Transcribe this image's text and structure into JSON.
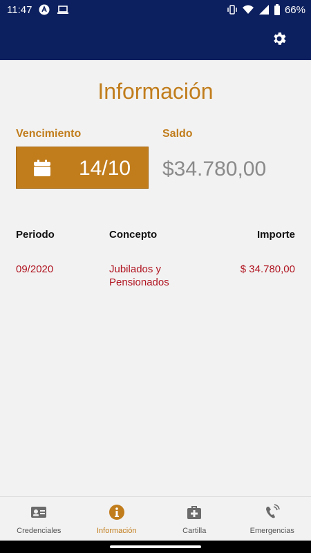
{
  "status_bar": {
    "time": "11:47",
    "battery": "66%"
  },
  "page": {
    "title": "Información"
  },
  "summary": {
    "vencimiento_label": "Vencimiento",
    "vencimiento_date": "14/10",
    "saldo_label": "Saldo",
    "saldo_value": "$34.780,00"
  },
  "table": {
    "headers": [
      "Periodo",
      "Concepto",
      "Importe"
    ],
    "rows": [
      {
        "periodo": "09/2020",
        "concepto": "Jubilados y Pensionados",
        "importe": "$ 34.780,00"
      }
    ]
  },
  "bottom_nav": {
    "items": [
      {
        "label": "Credenciales",
        "icon": "id-card-icon"
      },
      {
        "label": "Información",
        "icon": "info-icon"
      },
      {
        "label": "Cartilla",
        "icon": "medical-kit-icon"
      },
      {
        "label": "Emergencias",
        "icon": "phone-ring-icon"
      }
    ],
    "active": "Información"
  },
  "colors": {
    "primary": "#0c1f5e",
    "accent": "#c17d1c",
    "row_text": "#b01420",
    "saldo_text": "#8a8a8a"
  }
}
